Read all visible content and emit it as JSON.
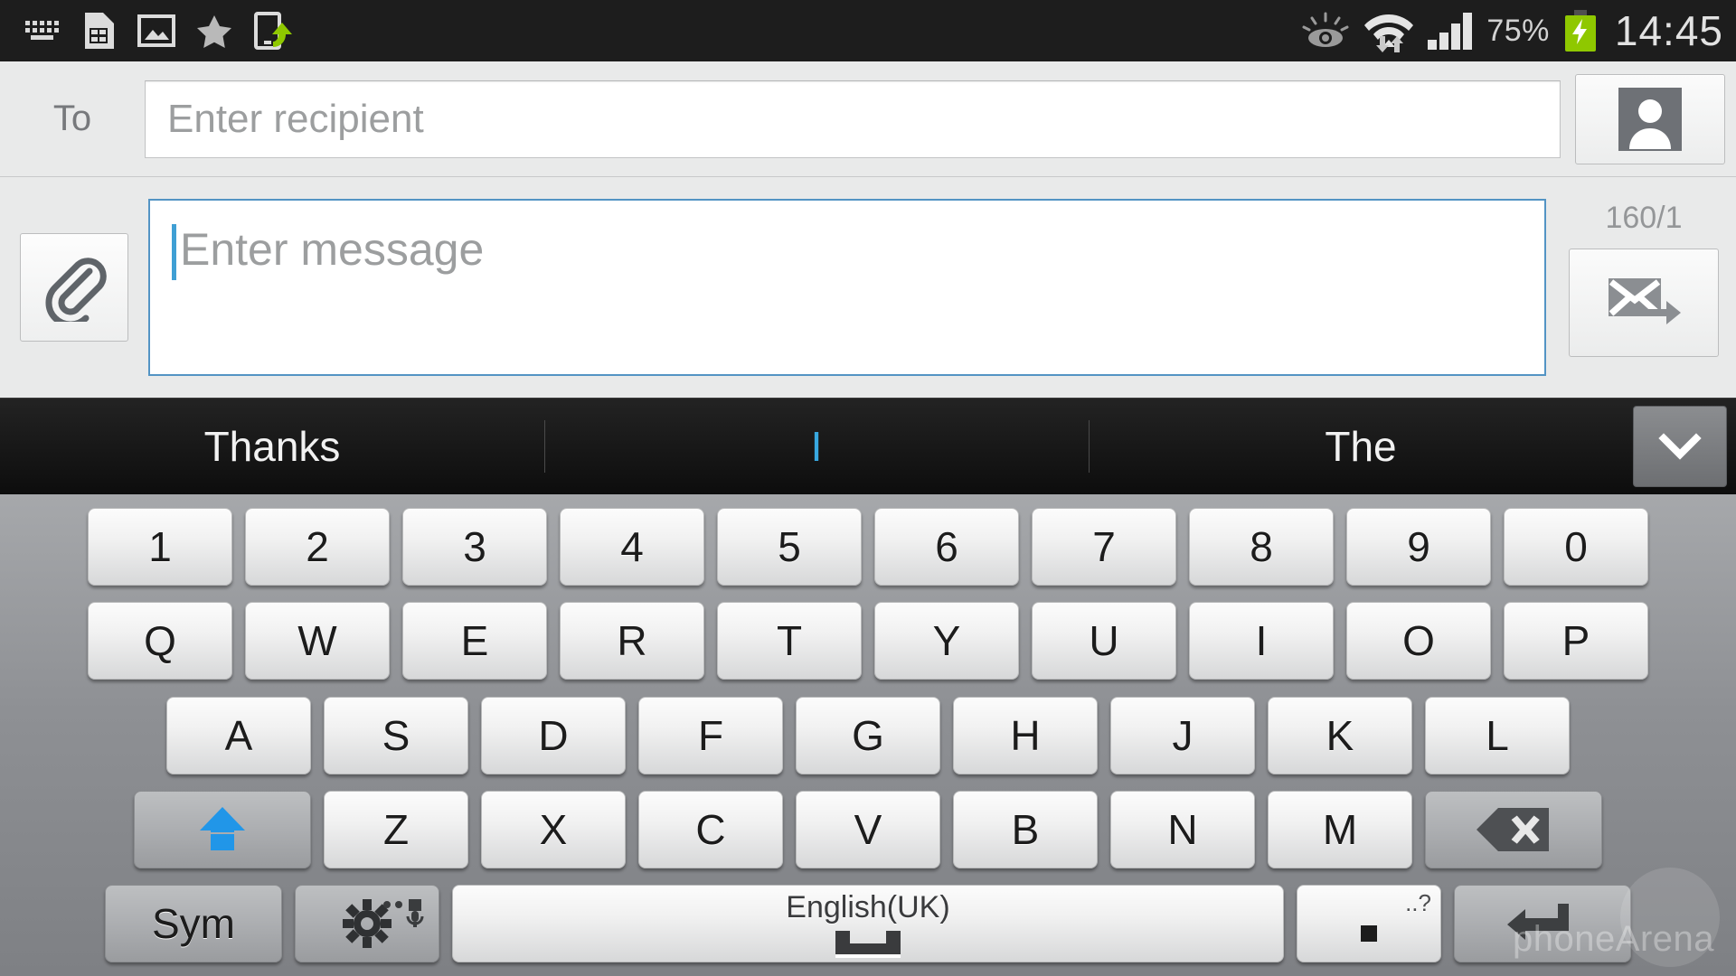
{
  "statusbar": {
    "left_icons": [
      "keyboard-icon",
      "sim-card-icon",
      "image-icon",
      "star-icon",
      "screen-share-icon"
    ],
    "right_icons": [
      "smart-stay-eye-icon",
      "wifi-icon",
      "signal-bars-icon"
    ],
    "battery_percent": "75%",
    "clock": "14:45",
    "battery_color": "#8fc800",
    "bg_color": "#1d1d1d"
  },
  "compose": {
    "to_label": "To",
    "recipient_placeholder": "Enter recipient",
    "recipient_value": "",
    "contact_button_icon": "contact-person-icon",
    "attach_button_icon": "paperclip-icon",
    "message_placeholder": "Enter message",
    "message_value": "",
    "char_counter": "160/1",
    "send_button_icon": "send-message-icon",
    "focus_color": "#5394c4",
    "caret_color": "#3f9fd4"
  },
  "suggestions": {
    "items": [
      {
        "label": "Thanks",
        "active": false
      },
      {
        "label": "I",
        "active": true
      },
      {
        "label": "The",
        "active": false
      }
    ],
    "expand_icon": "chevron-down-icon",
    "active_color": "#38a8e0"
  },
  "keyboard": {
    "language": "English(UK)",
    "shift_state": "on",
    "shift_color": "#2196e8",
    "rows": {
      "numbers": [
        "1",
        "2",
        "3",
        "4",
        "5",
        "6",
        "7",
        "8",
        "9",
        "0"
      ],
      "top": [
        "Q",
        "W",
        "E",
        "R",
        "T",
        "Y",
        "U",
        "I",
        "O",
        "P"
      ],
      "home": [
        "A",
        "S",
        "D",
        "F",
        "G",
        "H",
        "J",
        "K",
        "L"
      ],
      "bottom": [
        "Z",
        "X",
        "C",
        "V",
        "B",
        "N",
        "M"
      ]
    },
    "shift_key": "shift-key",
    "backspace_key": "backspace-key",
    "sym_key_label": "Sym",
    "settings_key_icon": "gear-icon",
    "mic_key_icon": "microphone-icon",
    "space_key_icon": "space-icon",
    "period_key_label": ".",
    "period_key_hint": "..?",
    "enter_key_icon": "enter-return-icon"
  },
  "watermark": {
    "text": "phoneArena"
  }
}
